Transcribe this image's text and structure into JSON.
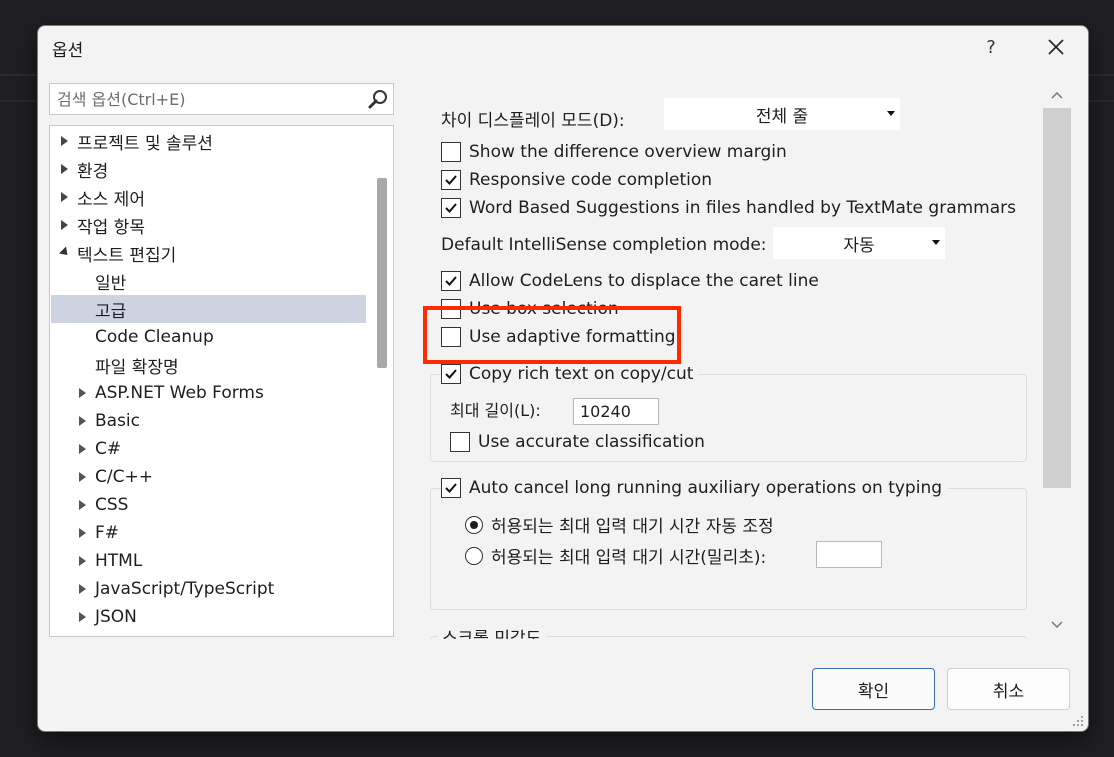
{
  "dialog": {
    "title": "옵션",
    "help_label": "?",
    "ok_label": "확인",
    "cancel_label": "취소"
  },
  "search": {
    "placeholder": "검색 옵션(Ctrl+E)"
  },
  "tree": {
    "items": [
      {
        "label": "프로젝트 및 솔루션"
      },
      {
        "label": "환경"
      },
      {
        "label": "소스 제어"
      },
      {
        "label": "작업 항목"
      },
      {
        "label": "텍스트 편집기"
      },
      {
        "label": "일반"
      },
      {
        "label": "고급"
      },
      {
        "label": "Code Cleanup"
      },
      {
        "label": "파일 확장명"
      },
      {
        "label": "ASP.NET Web Forms"
      },
      {
        "label": "Basic"
      },
      {
        "label": "C#"
      },
      {
        "label": "C/C++"
      },
      {
        "label": "CSS"
      },
      {
        "label": "F#"
      },
      {
        "label": "HTML"
      },
      {
        "label": "JavaScript/TypeScript"
      },
      {
        "label": "JSON"
      }
    ]
  },
  "settings": {
    "diff_display_label": "차이 디스플레이 모드(D):",
    "diff_display_value": "전체 줄",
    "show_diff_margin": {
      "label": "Show the difference overview margin",
      "checked": false
    },
    "responsive_completion": {
      "label": "Responsive code completion",
      "checked": true
    },
    "word_based": {
      "label": "Word Based Suggestions in files handled by TextMate grammars",
      "checked": true
    },
    "intellisense_mode_label": "Default IntelliSense completion mode:",
    "intellisense_mode_value": "자동",
    "codelens": {
      "label": "Allow CodeLens to displace the caret line",
      "checked": true
    },
    "box_selection": {
      "label": "Use box selection",
      "checked": false
    },
    "adaptive_formatting": {
      "label": "Use adaptive formatting",
      "checked": false
    },
    "copy_rich_text": {
      "label": "Copy rich text on copy/cut",
      "checked": true
    },
    "max_length_label": "최대 길이(L):",
    "max_length_value": "10240",
    "accurate_classification": {
      "label": "Use accurate classification",
      "checked": false
    },
    "auto_cancel": {
      "label": "Auto cancel long running auxiliary operations on typing",
      "checked": true
    },
    "radio_auto": {
      "label": "허용되는 최대 입력 대기 시간 자동 조정",
      "selected": true
    },
    "radio_ms": {
      "label": "허용되는 최대 입력 대기 시간(밀리초):",
      "selected": false
    },
    "ms_value": "",
    "scroll_sensitivity_label": "스크롤 민감도"
  },
  "colors": {
    "highlight": "#ff2a00",
    "selected_item": "#cdd3e0",
    "primary_border": "#3a70b5"
  }
}
